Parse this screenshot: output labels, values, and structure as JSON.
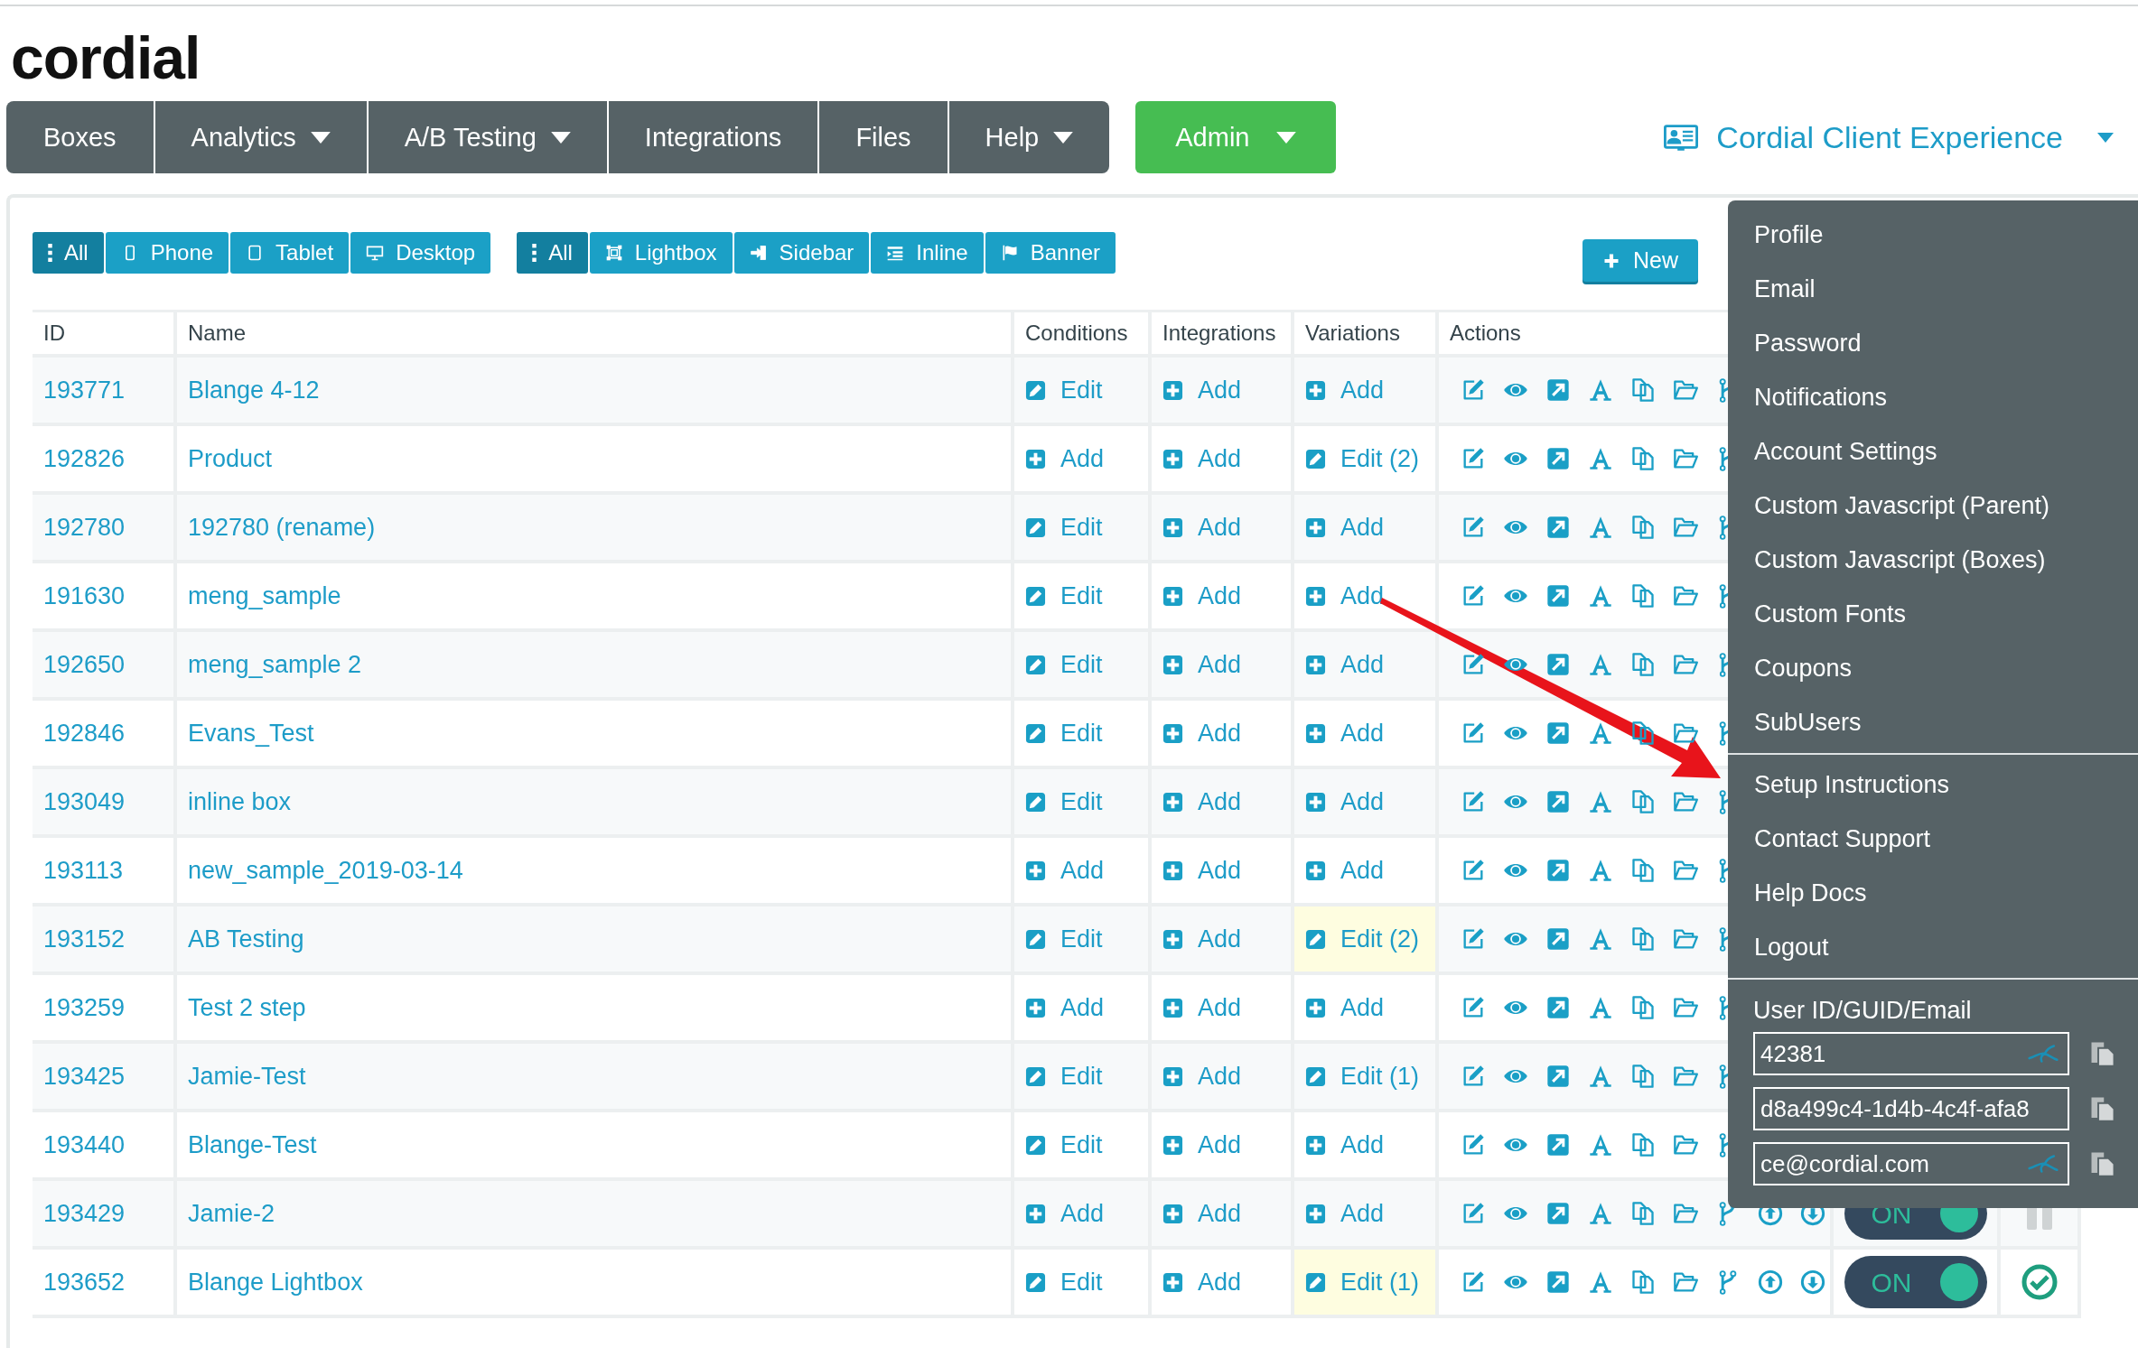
{
  "logo": "cordial",
  "nav": {
    "items": [
      {
        "label": "Boxes",
        "caret": false
      },
      {
        "label": "Analytics",
        "caret": true
      },
      {
        "label": "A/B Testing",
        "caret": true
      },
      {
        "label": "Integrations",
        "caret": false
      },
      {
        "label": "Files",
        "caret": false
      },
      {
        "label": "Help",
        "caret": true
      }
    ],
    "admin": {
      "label": "Admin",
      "caret": true
    }
  },
  "account": {
    "label": "Cordial Client Experience",
    "caret": true
  },
  "filters": {
    "devices": [
      {
        "kind": "all",
        "label": "All",
        "selected": true
      },
      {
        "kind": "phone",
        "label": "Phone",
        "selected": false
      },
      {
        "kind": "tablet",
        "label": "Tablet",
        "selected": false
      },
      {
        "kind": "desktop",
        "label": "Desktop",
        "selected": false
      }
    ],
    "types": [
      {
        "kind": "all",
        "label": "All",
        "selected": true
      },
      {
        "kind": "lightbox",
        "label": "Lightbox",
        "selected": false
      },
      {
        "kind": "sidebar",
        "label": "Sidebar",
        "selected": false
      },
      {
        "kind": "inline",
        "label": "Inline",
        "selected": false
      },
      {
        "kind": "banner",
        "label": "Banner",
        "selected": false
      }
    ]
  },
  "new_button": "New",
  "table": {
    "columns": [
      "ID",
      "Name",
      "Conditions",
      "Integrations",
      "Variations",
      "Actions"
    ],
    "rows": [
      {
        "id": "193771",
        "name": "Blange 4-12",
        "conditions": {
          "kind": "edit",
          "label": "Edit"
        },
        "integrations": {
          "kind": "add",
          "label": "Add"
        },
        "variations": {
          "kind": "add",
          "label": "Add",
          "highlighted": false
        }
      },
      {
        "id": "192826",
        "name": "Product",
        "conditions": {
          "kind": "add",
          "label": "Add"
        },
        "integrations": {
          "kind": "add",
          "label": "Add"
        },
        "variations": {
          "kind": "edit",
          "label": "Edit (2)",
          "highlighted": false
        }
      },
      {
        "id": "192780",
        "name": "192780 (rename)",
        "conditions": {
          "kind": "edit",
          "label": "Edit"
        },
        "integrations": {
          "kind": "add",
          "label": "Add"
        },
        "variations": {
          "kind": "add",
          "label": "Add",
          "highlighted": false
        }
      },
      {
        "id": "191630",
        "name": "meng_sample",
        "conditions": {
          "kind": "edit",
          "label": "Edit"
        },
        "integrations": {
          "kind": "add",
          "label": "Add"
        },
        "variations": {
          "kind": "add",
          "label": "Add",
          "highlighted": false
        }
      },
      {
        "id": "192650",
        "name": "meng_sample 2",
        "conditions": {
          "kind": "edit",
          "label": "Edit"
        },
        "integrations": {
          "kind": "add",
          "label": "Add"
        },
        "variations": {
          "kind": "add",
          "label": "Add",
          "highlighted": false
        }
      },
      {
        "id": "192846",
        "name": "Evans_Test",
        "conditions": {
          "kind": "edit",
          "label": "Edit"
        },
        "integrations": {
          "kind": "add",
          "label": "Add"
        },
        "variations": {
          "kind": "add",
          "label": "Add",
          "highlighted": false
        }
      },
      {
        "id": "193049",
        "name": "inline box",
        "conditions": {
          "kind": "edit",
          "label": "Edit"
        },
        "integrations": {
          "kind": "add",
          "label": "Add"
        },
        "variations": {
          "kind": "add",
          "label": "Add",
          "highlighted": false
        }
      },
      {
        "id": "193113",
        "name": "new_sample_2019-03-14",
        "conditions": {
          "kind": "add",
          "label": "Add"
        },
        "integrations": {
          "kind": "add",
          "label": "Add"
        },
        "variations": {
          "kind": "add",
          "label": "Add",
          "highlighted": false
        }
      },
      {
        "id": "193152",
        "name": "AB Testing",
        "conditions": {
          "kind": "edit",
          "label": "Edit"
        },
        "integrations": {
          "kind": "add",
          "label": "Add"
        },
        "variations": {
          "kind": "edit",
          "label": "Edit (2)",
          "highlighted": true
        }
      },
      {
        "id": "193259",
        "name": "Test 2 step",
        "conditions": {
          "kind": "add",
          "label": "Add"
        },
        "integrations": {
          "kind": "add",
          "label": "Add"
        },
        "variations": {
          "kind": "add",
          "label": "Add",
          "highlighted": false
        }
      },
      {
        "id": "193425",
        "name": "Jamie-Test",
        "conditions": {
          "kind": "edit",
          "label": "Edit"
        },
        "integrations": {
          "kind": "add",
          "label": "Add"
        },
        "variations": {
          "kind": "edit",
          "label": "Edit (1)",
          "highlighted": false
        }
      },
      {
        "id": "193440",
        "name": "Blange-Test",
        "conditions": {
          "kind": "edit",
          "label": "Edit"
        },
        "integrations": {
          "kind": "add",
          "label": "Add"
        },
        "variations": {
          "kind": "add",
          "label": "Add",
          "highlighted": false
        }
      },
      {
        "id": "193429",
        "name": "Jamie-2",
        "conditions": {
          "kind": "add",
          "label": "Add"
        },
        "integrations": {
          "kind": "add",
          "label": "Add"
        },
        "variations": {
          "kind": "add",
          "label": "Add",
          "highlighted": false
        },
        "toggle": {
          "label": "ON",
          "on": true
        },
        "status": {
          "kind": "paused"
        }
      },
      {
        "id": "193652",
        "name": "Blange Lightbox",
        "conditions": {
          "kind": "edit",
          "label": "Edit"
        },
        "integrations": {
          "kind": "add",
          "label": "Add"
        },
        "variations": {
          "kind": "edit",
          "label": "Edit (1)",
          "highlighted": true
        },
        "toggle": {
          "label": "ON",
          "on": true
        },
        "status": {
          "kind": "active"
        }
      }
    ]
  },
  "account_menu": {
    "groups": [
      [
        "Profile",
        "Email",
        "Password",
        "Notifications",
        "Account Settings",
        "Custom Javascript (Parent)",
        "Custom Javascript (Boxes)",
        "Custom Fonts",
        "Coupons",
        "SubUsers"
      ],
      [
        "Setup Instructions",
        "Contact Support",
        "Help Docs",
        "Logout"
      ]
    ],
    "user_label": "User ID/GUID/Email",
    "user_fields": [
      {
        "value": "42381",
        "switch_user": true
      },
      {
        "value": "d8a499c4-1d4b-4c4f-afa8",
        "switch_user": false
      },
      {
        "value": "ce@cordial.com",
        "switch_user": true
      }
    ]
  }
}
